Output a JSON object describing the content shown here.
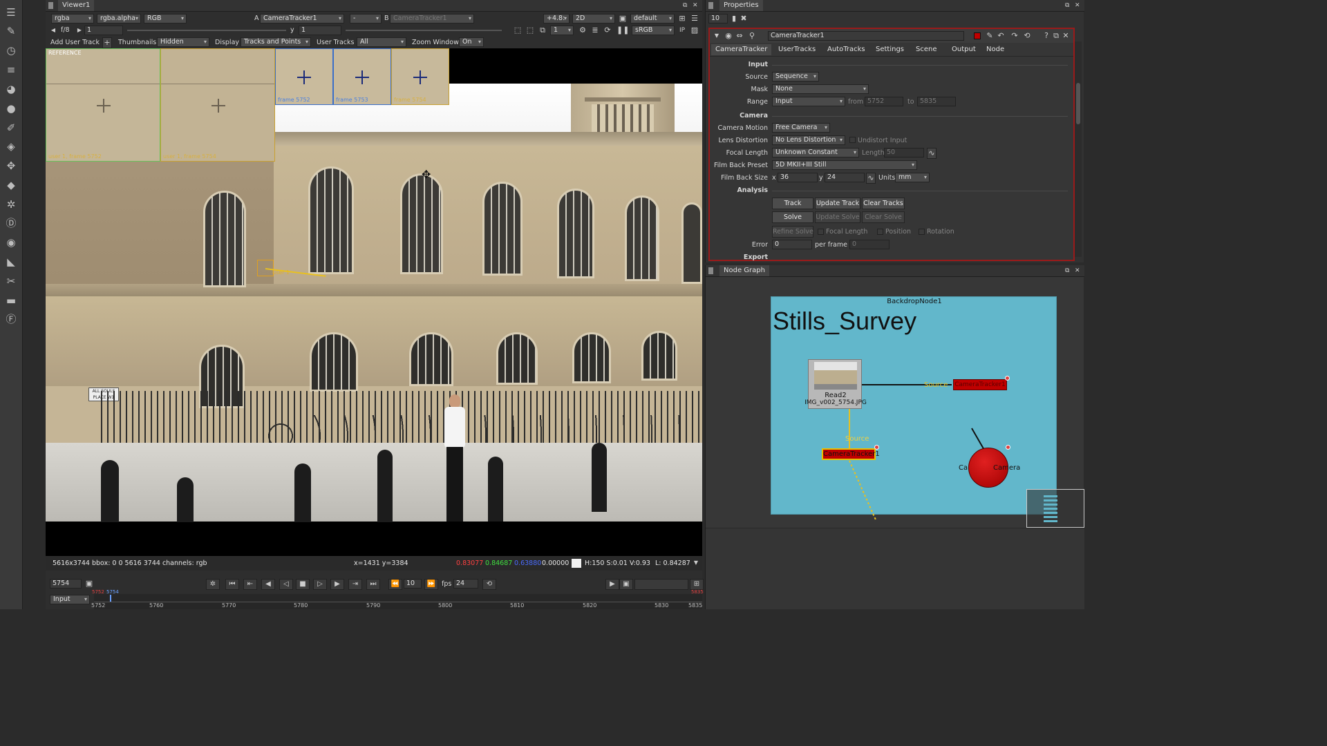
{
  "left_toolbar": {
    "icons": [
      "menu-icon",
      "draw-icon",
      "time-icon",
      "channel-icon",
      "color-icon",
      "filter-icon",
      "keyer-icon",
      "merge-icon",
      "transform-icon",
      "3d-icon",
      "particles-icon",
      "deep-icon",
      "views-icon",
      "metadata-icon",
      "toolsets-icon",
      "other-icon",
      "furnace-icon"
    ]
  },
  "viewer": {
    "tab": "Viewer1",
    "top_bar": {
      "channels": "rgba",
      "alpha": "rgba.alpha",
      "colorspace": "RGB",
      "a_label": "A",
      "input_a": "CameraTracker1",
      "a_op": "-",
      "b_label": "B",
      "input_b": "CameraTracker1",
      "gain": "+4.8:",
      "mode": "2D",
      "lut_default": "default",
      "lut": "sRGB"
    },
    "second_bar": {
      "fstop": "f/8",
      "gain_value": "1",
      "y_label": "y",
      "gamma_value": "1",
      "proxy": "1"
    },
    "overlay_bar": {
      "add_user_track": "Add User Track",
      "thumbnails_label": "Thumbnails",
      "thumbnails_value": "Hidden",
      "display_label": "Display",
      "display_value": "Tracks and Points",
      "user_tracks_label": "User Tracks",
      "user_tracks_value": "All",
      "zoom_window_label": "Zoom Window",
      "zoom_window_value": "On"
    },
    "thumbnails": [
      {
        "caption": "REFERENCE",
        "bottom": "user 1, frame 5752"
      },
      {
        "caption": "",
        "bottom": "user 1, frame 5754"
      },
      {
        "caption": "",
        "bottom": "frame 5752"
      },
      {
        "caption": "",
        "bottom": "frame 5753"
      },
      {
        "caption": "",
        "bottom": "frame 5754"
      }
    ],
    "track_label": "user 1",
    "scene_signs": [
      "ALL SOULS",
      "PLACE W1"
    ],
    "status": {
      "info": "5616x3744 bbox: 0 0 5616 3744 channels: rgb",
      "coords": "x=1431 y=3384",
      "r": "0.83077",
      "g": "0.84687",
      "b": "0.63880",
      "a": "0.00000",
      "hsv": "H:150 S:0.01 V:0.93",
      "luma": "L: 0.84287"
    },
    "playback": {
      "frame": "5754",
      "increment": "10",
      "fps_label": "fps",
      "fps": "24",
      "input_mode": "Input",
      "range_start": "5752",
      "range_current": "5754",
      "range_end": "5835"
    },
    "timeline_ticks": [
      "5752",
      "5760",
      "5770",
      "5780",
      "5790",
      "5800",
      "5810",
      "5820",
      "5830",
      "5835"
    ]
  },
  "properties": {
    "tab": "Properties",
    "max_panels": "10",
    "node_name": "CameraTracker1",
    "tabs": [
      "CameraTracker",
      "UserTracks",
      "AutoTracks",
      "Settings",
      "Scene",
      "Output",
      "Node"
    ],
    "fields": {
      "input_header": "Input",
      "source_label": "Source",
      "source": "Sequence",
      "mask_label": "Mask",
      "mask": "None",
      "range_label": "Range",
      "range": "Input",
      "from_label": "from",
      "range_from": "5752",
      "to_label": "to",
      "range_to": "5835",
      "camera_header": "Camera",
      "camera_motion_label": "Camera Motion",
      "camera_motion": "Free Camera",
      "lens_distortion_label": "Lens Distortion",
      "lens_distortion": "No Lens Distortion",
      "undistort_input": "Undistort Input",
      "focal_length_label": "Focal Length",
      "focal_length": "Unknown Constant",
      "length_label": "Length",
      "length": "50",
      "film_back_preset_label": "Film Back Preset",
      "film_back_preset": "5D MKII+III Still",
      "film_back_size_label": "Film Back Size",
      "x_label": "x",
      "film_x": "36",
      "y_label": "y",
      "film_y": "24",
      "units_label": "Units",
      "units": "mm",
      "analysis_header": "Analysis",
      "track": "Track",
      "update_track": "Update Track",
      "clear_tracks": "Clear Tracks",
      "solve": "Solve",
      "update_solve": "Update Solve",
      "clear_solve": "Clear Solve",
      "refine_solve": "Refine Solve",
      "refine_focal": "Focal Length",
      "refine_position": "Position",
      "refine_rotation": "Rotation",
      "error_label": "Error",
      "error": "0",
      "per_frame_label": "per frame",
      "per_frame": "0",
      "export_header": "Export"
    }
  },
  "node_graph": {
    "tab": "Node Graph",
    "backdrop_name": "BackdropNode1",
    "backdrop_title": "Stills_Survey",
    "read_node": "Read2",
    "read_file": "IMG_v002_5754.JPG",
    "source_label_1": "Source",
    "source_label_2": "Source",
    "camera_tracker_node": "CameraTracker1",
    "camera_tracker_node_2": "CameraTracker1",
    "camera_node": "Camera",
    "camera_prefix": "Ca",
    "colors": {
      "backdrop": "#62b7cb",
      "node_red": "#c00000",
      "node_selected": "#e8c000"
    }
  }
}
